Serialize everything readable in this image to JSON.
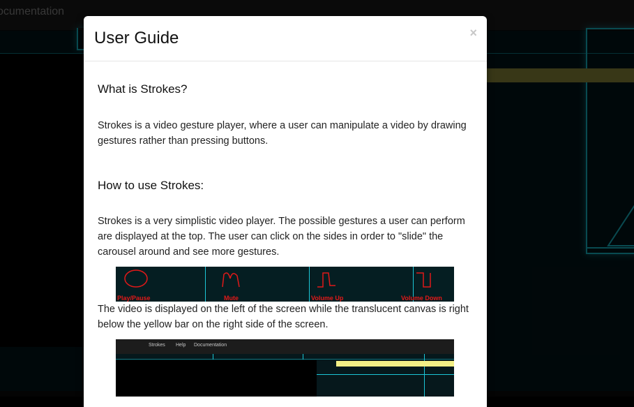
{
  "navbar": {
    "partial_link": "ocumentation"
  },
  "modal": {
    "title": "User Guide",
    "close_symbol": "×",
    "sections": [
      {
        "heading": "What is Strokes?",
        "paragraph": "Strokes is a video gesture player, where a user can manipulate a video by drawing gestures rather than pressing buttons."
      },
      {
        "heading": "How to use Strokes:",
        "paragraph": "Strokes is a very simplistic video player. The possible gestures a user can perform are displayed at the top. The user can click on the sides in order to \"slide\" the carousel around and see more gestures."
      }
    ],
    "after_image_paragraph": "The video is displayed on the left of the screen while the translucent canvas is right below the yellow bar on the right side of the screen.",
    "gesture_labels": [
      "Play/Pause",
      "Mute",
      "Volume Up",
      "Volume Down"
    ],
    "screenshot_nav": [
      "Strokes",
      "Help",
      "Documentation"
    ]
  },
  "colors": {
    "accent_cyan": "#18b8c8",
    "yellow_bar": "#8d8b3a",
    "gesture_red": "#e01919"
  }
}
